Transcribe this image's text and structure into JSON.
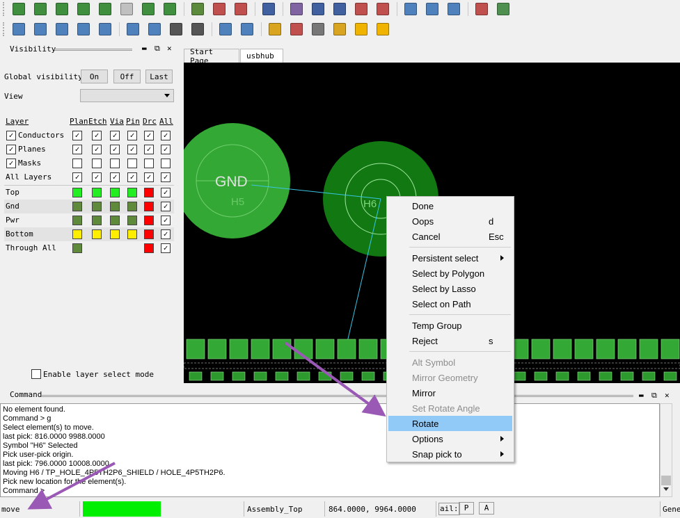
{
  "toolbar_row1": [
    {
      "icon": "save-icon",
      "color": "#3f8f3f"
    },
    {
      "icon": "open-icon",
      "color": "#3f8f3f"
    },
    {
      "icon": "import-icon",
      "color": "#3f8f3f"
    },
    {
      "icon": "export-icon",
      "color": "#3f8f3f"
    },
    {
      "icon": "plot-icon",
      "color": "#3f8f3f"
    },
    {
      "icon": "disabled-icon",
      "color": "#c0c0c0"
    },
    {
      "icon": "edit-icon",
      "color": "#3f8f3f"
    },
    {
      "icon": "pad-icon",
      "color": "#3f8f3f"
    },
    {
      "icon": "sep"
    },
    {
      "icon": "board-icon",
      "color": "#5b8a3c"
    },
    {
      "icon": "dimension-icon",
      "color": "#c0504d"
    },
    {
      "icon": "measure-icon",
      "color": "#c0504d"
    },
    {
      "icon": "sep"
    },
    {
      "icon": "route-icon",
      "color": "#4060a0"
    },
    {
      "icon": "sep"
    },
    {
      "icon": "report-icon",
      "color": "#8064a2"
    },
    {
      "icon": "book-icon",
      "color": "#4060a0"
    },
    {
      "icon": "library-icon",
      "color": "#4060a0"
    },
    {
      "icon": "checklist-icon",
      "color": "#c0504d"
    },
    {
      "icon": "tool-icon",
      "color": "#c0504d"
    },
    {
      "icon": "sep"
    },
    {
      "icon": "add-net-icon",
      "color": "#4f81bd"
    },
    {
      "icon": "pen-icon",
      "color": "#4f81bd"
    },
    {
      "icon": "search-net-icon",
      "color": "#4f81bd"
    },
    {
      "icon": "sep"
    },
    {
      "icon": "list-icon",
      "color": "#c0504d"
    },
    {
      "icon": "hierarchy-icon",
      "color": "#4f8f4f"
    }
  ],
  "toolbar_row2": [
    {
      "icon": "pin-icon",
      "color": "#4f81bd"
    },
    {
      "icon": "rectangle-icon",
      "color": "#4f81bd"
    },
    {
      "icon": "circle-icon",
      "color": "#4f81bd"
    },
    {
      "icon": "select-arrow-icon",
      "color": "#4f81bd"
    },
    {
      "icon": "frame-icon",
      "color": "#4f81bd"
    },
    {
      "icon": "sep"
    },
    {
      "icon": "layers-icon",
      "color": "#4f81bd"
    },
    {
      "icon": "shape-icon",
      "color": "#4f81bd"
    },
    {
      "icon": "camera-icon",
      "color": "#555555"
    },
    {
      "icon": "refdes-icon",
      "color": "#555555"
    },
    {
      "icon": "sep"
    },
    {
      "icon": "copy-icon",
      "color": "#4f81bd"
    },
    {
      "icon": "move-icon",
      "color": "#4f81bd"
    },
    {
      "icon": "sep"
    },
    {
      "icon": "info-icon",
      "color": "#d9a520"
    },
    {
      "icon": "status-icon",
      "color": "#c0504d"
    },
    {
      "icon": "number-icon",
      "color": "#777777"
    },
    {
      "icon": "broom-icon",
      "color": "#d9a520"
    },
    {
      "icon": "sun-icon",
      "color": "#f0b400"
    },
    {
      "icon": "sun-gear-icon",
      "color": "#f0b400"
    }
  ],
  "visibility": {
    "title": "Visibility",
    "global_label": "Global visibility",
    "btn_on": "On",
    "btn_off": "Off",
    "btn_last": "Last",
    "view_label": "View",
    "view_value": "",
    "headers": {
      "layer": "Layer",
      "plan": "Plan",
      "etch": "Etch",
      "via": "Via",
      "pin": "Pin",
      "drc": "Drc",
      "all": "All"
    },
    "groups": [
      {
        "label": "Conductors",
        "checked": true,
        "cells": [
          true,
          true,
          true,
          true,
          true,
          true
        ]
      },
      {
        "label": "Planes",
        "checked": true,
        "cells": [
          true,
          true,
          true,
          true,
          true,
          true
        ]
      },
      {
        "label": "Masks",
        "checked": true,
        "cells": [
          false,
          false,
          false,
          false,
          false,
          false
        ]
      },
      {
        "label": "All Layers",
        "checked": null,
        "cells": [
          true,
          true,
          true,
          true,
          true,
          true
        ]
      }
    ],
    "layers": [
      {
        "label": "Top",
        "colors": [
          "#22ee22",
          "#22ee22",
          "#22ee22",
          "#22ee22",
          "#ff0000"
        ],
        "all": true
      },
      {
        "label": "Gnd",
        "colors": [
          "#5f8a3c",
          "#5f8a3c",
          "#5f8a3c",
          "#5f8a3c",
          "#ff0000"
        ],
        "all": true
      },
      {
        "label": "Pwr",
        "colors": [
          "#5f8a3c",
          "#5f8a3c",
          "#5f8a3c",
          "#5f8a3c",
          "#ff0000"
        ],
        "all": true
      },
      {
        "label": "Bottom",
        "colors": [
          "#ffee00",
          "#ffee00",
          "#ffee00",
          "#ffee00",
          "#ff0000"
        ],
        "all": true
      },
      {
        "label": "Through All",
        "colors": [
          "#5f8a3c",
          null,
          null,
          null,
          "#ff0000"
        ],
        "all": true
      }
    ],
    "enable_label": "Enable layer select mode"
  },
  "tabs": [
    "Start Page",
    "usbhub"
  ],
  "canvas": {
    "gnd_label": "GND",
    "h6_label": "H6",
    "h5_label": "H5"
  },
  "command": {
    "title": "Command",
    "lines": [
      "No element found.",
      "Command > g",
      "Select element(s) to move.",
      "last pick:  816.0000 9988.0000",
      "Symbol \"H6\" Selected",
      "Pick user-pick origin.",
      "last pick:  796.0000 10008.0000",
      "Moving H6 / TP_HOLE_4P5TH2P6_SHIELD / HOLE_4P5TH2P6.",
      "Pick new location for the element(s).",
      "Command >"
    ]
  },
  "context_menu": [
    {
      "label": "Done",
      "shortcut": ""
    },
    {
      "label": "Oops",
      "shortcut": "d"
    },
    {
      "label": "Cancel",
      "shortcut": "Esc"
    },
    {
      "sep": true
    },
    {
      "label": "Persistent select",
      "submenu": true
    },
    {
      "label": "Select by Polygon"
    },
    {
      "label": "Select by Lasso"
    },
    {
      "label": "Select on Path"
    },
    {
      "sep": true
    },
    {
      "label": "Temp Group"
    },
    {
      "label": "Reject",
      "shortcut": "s"
    },
    {
      "sep": true
    },
    {
      "label": "Alt Symbol",
      "disabled": true
    },
    {
      "label": "Mirror Geometry",
      "disabled": true
    },
    {
      "label": "Mirror"
    },
    {
      "label": "Set Rotate Angle",
      "disabled": true
    },
    {
      "label": "Rotate",
      "highlighted": true
    },
    {
      "label": "Options",
      "submenu": true
    },
    {
      "label": "Snap pick to",
      "submenu": true
    }
  ],
  "status": {
    "mode": "move",
    "indicator_color": "#00ee00",
    "subclass": "Assembly_Top",
    "coords": "864.0000, 9964.0000",
    "ail_label": "ail:",
    "p_label": "P",
    "a_label": "A",
    "gene_label": "Gene"
  },
  "colors": {
    "pad_light": "#34a834",
    "pad_dark": "#127812",
    "ratsnest": "#39c6e6",
    "annotation_arrow": "#9b59b6",
    "menu_highlight": "#91c9f7"
  }
}
